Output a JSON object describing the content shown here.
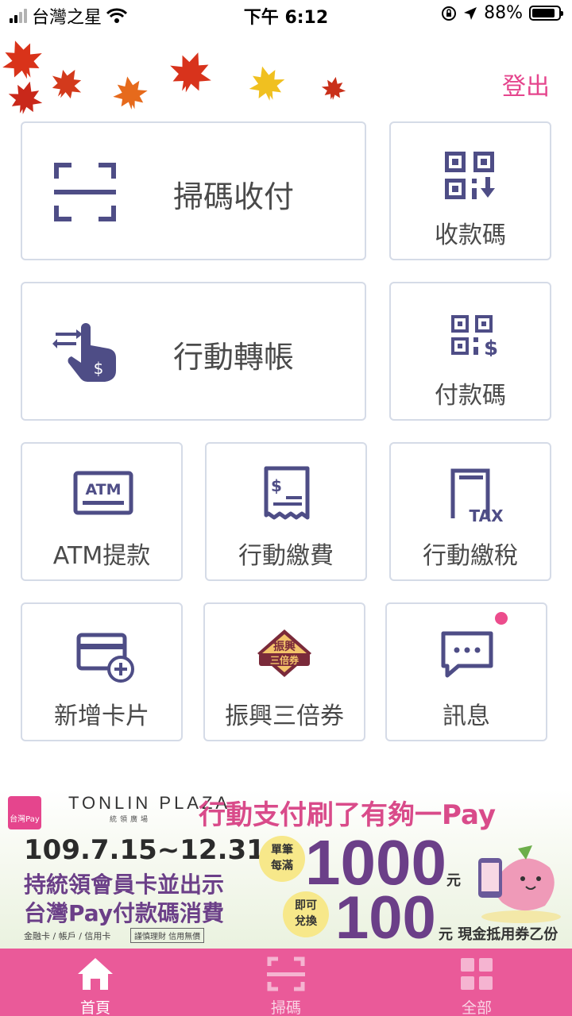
{
  "status_bar": {
    "carrier": "台灣之星",
    "time": "下午 6:12",
    "battery": "88%",
    "battery_level": 0.88
  },
  "header": {
    "logout_label": "登出"
  },
  "tiles": {
    "scan_pay": "掃碼收付",
    "receive_code": "收款碼",
    "mobile_transfer": "行動轉帳",
    "pay_code": "付款碼",
    "atm_withdraw": "ATM提款",
    "mobile_bill": "行動繳費",
    "mobile_tax": "行動繳稅",
    "add_card": "新增卡片",
    "triple_voucher": "振興三倍券",
    "messages": "訊息"
  },
  "icon_text": {
    "atm": "ATM",
    "tax": "TAX",
    "voucher_top": "振興",
    "voucher_bottom": "三倍券"
  },
  "banner": {
    "app_logo": "台灣Pay",
    "brand": "TONLIN PLAZA",
    "brand_sub": "統領廣場",
    "headline": "行動支付刷了有夠一Pay",
    "date_range": "109.7.15~12.31",
    "line2": "持統領會員卡並出示",
    "line3": "台灣Pay付款碼消費",
    "methods": "金融卡 / 帳戶 / 信用卡",
    "disclaimer": "謹慎理財 信用無價",
    "badge1": "單筆每滿",
    "amount1": "1000",
    "unit1": "元",
    "badge2": "即可兌換",
    "amount2": "100",
    "tail": "元 現金抵用券乙份"
  },
  "tabbar": {
    "home": "首頁",
    "scan": "掃碼",
    "all": "全部"
  },
  "colors": {
    "accent": "#e5458d",
    "icon": "#4e4d86",
    "tabbar": "#ea5a99",
    "tile_border": "#d5dbe7"
  }
}
